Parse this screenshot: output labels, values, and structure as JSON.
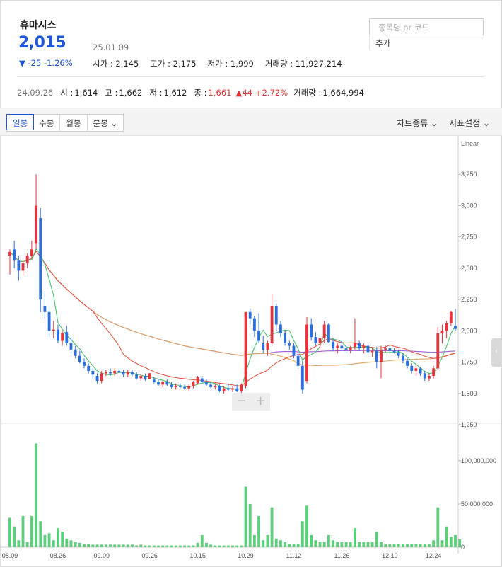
{
  "stock": {
    "name": "휴마시스",
    "price": "2,015",
    "change_icon": "▼",
    "change": "-25",
    "change_pct": "-1.26%",
    "date": "25.01.09",
    "open_text": "시가 : 2,145",
    "high_text": "고가 : 2,175",
    "low_text": "저가 : 1,999",
    "volume_text": "거래량 : 11,927,214"
  },
  "search": {
    "placeholder": "종목명 or 코드",
    "add_label": "추가"
  },
  "cursor": {
    "date": "24.09.26",
    "open_label": "시 :",
    "open": "1,614",
    "high_label": "고 :",
    "high": "1,662",
    "low_label": "저 :",
    "low": "1,612",
    "close_label": "종 :",
    "close": "1,661",
    "change_icon": "▲",
    "change": "44",
    "change_pct": "+2.72%",
    "volume_label": "거래량 :",
    "volume": "1,664,994"
  },
  "toolbar": {
    "tabs": [
      "일봉",
      "주봉",
      "월봉",
      "분봉"
    ],
    "chart_type": "차트종류",
    "indicators": "지표설정"
  },
  "zoom": {
    "minus": "−",
    "plus": "+"
  },
  "colors": {
    "up": "#e8323c",
    "down": "#2b6fdf",
    "volume": "#5ccf7b",
    "price_blue": "#1e56d6"
  },
  "chart_data": {
    "type": "candlestick",
    "scale_label": "Linear",
    "price_ticks": [
      1250,
      1500,
      1750,
      2000,
      2250,
      2500,
      2750,
      3000,
      3250
    ],
    "price_range": [
      1250,
      3500
    ],
    "volume_ticks": [
      {
        "value": 0,
        "label": "0"
      },
      {
        "value": 50000000,
        "label": "50,000,000"
      },
      {
        "value": 100000000,
        "label": "100,000,000"
      }
    ],
    "volume_range": [
      0,
      140000000
    ],
    "x_labels": [
      {
        "index": 0,
        "label": "08.09"
      },
      {
        "index": 11,
        "label": "08.26"
      },
      {
        "index": 21,
        "label": "09.09"
      },
      {
        "index": 32,
        "label": "09.26"
      },
      {
        "index": 43,
        "label": "10.15"
      },
      {
        "index": 54,
        "label": "10.29"
      },
      {
        "index": 65,
        "label": "11.12"
      },
      {
        "index": 76,
        "label": "11.26"
      },
      {
        "index": 87,
        "label": "12.10"
      },
      {
        "index": 97,
        "label": "12.24"
      }
    ],
    "candles": [
      [
        2600,
        2650,
        2450,
        2630
      ],
      [
        2650,
        2720,
        2500,
        2560
      ],
      [
        2560,
        2600,
        2400,
        2480
      ],
      [
        2480,
        2560,
        2440,
        2540
      ],
      [
        2540,
        2620,
        2500,
        2600
      ],
      [
        2600,
        2720,
        2580,
        2650
      ],
      [
        2700,
        3250,
        2650,
        3000
      ],
      [
        2900,
        2980,
        2150,
        2250
      ],
      [
        2200,
        2320,
        2100,
        2150
      ],
      [
        2150,
        2200,
        1950,
        2000
      ],
      [
        2000,
        2080,
        1940,
        2010
      ],
      [
        2010,
        2050,
        1900,
        1920
      ],
      [
        1920,
        2000,
        1880,
        1980
      ],
      [
        1990,
        2040,
        1880,
        1900
      ],
      [
        1900,
        1950,
        1820,
        1850
      ],
      [
        1850,
        1880,
        1780,
        1800
      ],
      [
        1800,
        1840,
        1740,
        1750
      ],
      [
        1750,
        1780,
        1700,
        1720
      ],
      [
        1720,
        1740,
        1660,
        1680
      ],
      [
        1680,
        1700,
        1620,
        1650
      ],
      [
        1640,
        1660,
        1580,
        1600
      ],
      [
        1600,
        1680,
        1580,
        1660
      ],
      [
        1660,
        1690,
        1640,
        1670
      ],
      [
        1670,
        1700,
        1640,
        1660
      ],
      [
        1660,
        1700,
        1640,
        1680
      ],
      [
        1680,
        1700,
        1650,
        1670
      ],
      [
        1670,
        1690,
        1630,
        1650
      ],
      [
        1650,
        1690,
        1630,
        1670
      ],
      [
        1670,
        1690,
        1640,
        1650
      ],
      [
        1650,
        1670,
        1610,
        1620
      ],
      [
        1620,
        1650,
        1600,
        1640
      ],
      [
        1640,
        1660,
        1600,
        1610
      ],
      [
        1614,
        1662,
        1612,
        1661
      ],
      [
        1610,
        1630,
        1580,
        1590
      ],
      [
        1590,
        1610,
        1560,
        1570
      ],
      [
        1570,
        1600,
        1550,
        1590
      ],
      [
        1590,
        1610,
        1560,
        1570
      ],
      [
        1570,
        1590,
        1540,
        1550
      ],
      [
        1550,
        1580,
        1530,
        1560
      ],
      [
        1560,
        1580,
        1540,
        1550
      ],
      [
        1550,
        1570,
        1530,
        1540
      ],
      [
        1540,
        1570,
        1520,
        1560
      ],
      [
        1560,
        1600,
        1540,
        1590
      ],
      [
        1580,
        1640,
        1570,
        1630
      ],
      [
        1620,
        1640,
        1580,
        1590
      ],
      [
        1590,
        1610,
        1560,
        1570
      ],
      [
        1570,
        1590,
        1540,
        1550
      ],
      [
        1550,
        1580,
        1530,
        1560
      ],
      [
        1560,
        1570,
        1510,
        1520
      ],
      [
        1520,
        1560,
        1500,
        1540
      ],
      [
        1540,
        1580,
        1520,
        1530
      ],
      [
        1530,
        1560,
        1510,
        1540
      ],
      [
        1540,
        1570,
        1510,
        1520
      ],
      [
        1520,
        1580,
        1500,
        1570
      ],
      [
        1560,
        2000,
        1540,
        2150
      ],
      [
        2150,
        2180,
        2050,
        2100
      ],
      [
        2100,
        2120,
        1950,
        2000
      ],
      [
        2000,
        2140,
        1900,
        1920
      ],
      [
        1900,
        1960,
        1820,
        1850
      ],
      [
        1850,
        1920,
        1800,
        1900
      ],
      [
        1900,
        2290,
        1880,
        2200
      ],
      [
        2200,
        2220,
        2000,
        2050
      ],
      [
        2050,
        2080,
        1950,
        1980
      ],
      [
        1980,
        2000,
        1880,
        1900
      ],
      [
        1900,
        1920,
        1850,
        1880
      ],
      [
        1880,
        1900,
        1780,
        1800
      ],
      [
        1800,
        1820,
        1700,
        1720
      ],
      [
        1720,
        1760,
        1500,
        1530
      ],
      [
        1600,
        2110,
        1580,
        2050
      ],
      [
        2050,
        2100,
        1920,
        1950
      ],
      [
        1950,
        1990,
        1880,
        1900
      ],
      [
        1900,
        1950,
        1850,
        1940
      ],
      [
        1940,
        2080,
        1900,
        2050
      ],
      [
        2050,
        2060,
        1900,
        1910
      ],
      [
        1910,
        1940,
        1840,
        1860
      ],
      [
        1860,
        1900,
        1820,
        1880
      ],
      [
        1880,
        1920,
        1840,
        1860
      ],
      [
        1860,
        1880,
        1820,
        1850
      ],
      [
        1850,
        1880,
        1820,
        1870
      ],
      [
        1870,
        2100,
        1850,
        1900
      ],
      [
        1900,
        1920,
        1840,
        1860
      ],
      [
        1860,
        1900,
        1820,
        1880
      ],
      [
        1880,
        1900,
        1820,
        1830
      ],
      [
        1830,
        1860,
        1790,
        1840
      ],
      [
        1840,
        1870,
        1700,
        1750
      ],
      [
        1750,
        1880,
        1620,
        1850
      ],
      [
        1850,
        1880,
        1830,
        1860
      ],
      [
        1860,
        1880,
        1830,
        1840
      ],
      [
        1840,
        1860,
        1820,
        1830
      ],
      [
        1830,
        1850,
        1780,
        1800
      ],
      [
        1800,
        1820,
        1740,
        1760
      ],
      [
        1760,
        1780,
        1700,
        1720
      ],
      [
        1720,
        1740,
        1660,
        1680
      ],
      [
        1680,
        1720,
        1640,
        1700
      ],
      [
        1700,
        1710,
        1640,
        1660
      ],
      [
        1660,
        1680,
        1600,
        1620
      ],
      [
        1620,
        1660,
        1600,
        1640
      ],
      [
        1640,
        1720,
        1620,
        1700
      ],
      [
        1700,
        2030,
        1690,
        1980
      ],
      [
        1980,
        2050,
        1900,
        2000
      ],
      [
        2000,
        2080,
        1940,
        2060
      ],
      [
        2060,
        2160,
        2040,
        2150
      ],
      [
        2040,
        2175,
        1999,
        2015
      ]
    ],
    "volume": [
      34,
      24,
      8,
      36,
      6,
      36,
      120,
      30,
      14,
      16,
      8,
      22,
      18,
      10,
      8,
      6,
      5,
      4,
      4,
      3,
      3,
      3,
      3,
      3,
      3,
      3,
      3,
      3,
      3,
      2,
      3,
      2,
      2,
      2,
      2,
      2,
      2,
      2,
      2,
      2,
      2,
      2,
      2,
      5,
      14,
      5,
      3,
      2,
      2,
      2,
      2,
      2,
      2,
      2,
      70,
      50,
      14,
      36,
      8,
      14,
      46,
      10,
      8,
      6,
      4,
      4,
      4,
      30,
      48,
      14,
      8,
      6,
      6,
      14,
      8,
      6,
      6,
      6,
      6,
      22,
      6,
      6,
      6,
      6,
      18,
      6,
      4,
      4,
      4,
      4,
      4,
      4,
      4,
      4,
      4,
      4,
      4,
      8,
      46,
      8,
      24,
      12,
      14,
      9
    ],
    "ma_series": [
      {
        "color": "#4cbf6d",
        "period": 5
      },
      {
        "color": "#e05a46",
        "period": 20
      },
      {
        "color": "#e0a460",
        "period": 60
      },
      {
        "color": "#a65ddc",
        "period": 120
      }
    ]
  }
}
